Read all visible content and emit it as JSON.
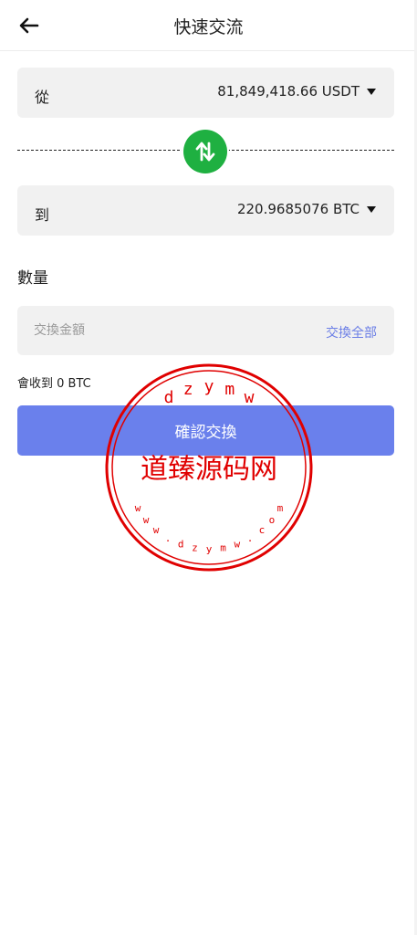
{
  "header": {
    "title": "快速交流",
    "back_icon": "arrow-left-icon"
  },
  "from": {
    "label": "從",
    "value": "81,849,418.66 USDT"
  },
  "to": {
    "label": "到",
    "value": "220.9685076 BTC"
  },
  "swap": {
    "icon": "swap-arrows-icon",
    "color": "#1fb041"
  },
  "amount": {
    "title": "數量",
    "placeholder": "交換金額",
    "value": "",
    "exchange_all": "交換全部"
  },
  "receive": "會收到 0 BTC",
  "confirm": {
    "label": "確認交換",
    "color": "#6a80ec"
  },
  "watermark": {
    "text": "道臻源码网",
    "top_arc": "dzymw",
    "bottom_arc": "www.dzymw.com",
    "color": "#e00000"
  }
}
